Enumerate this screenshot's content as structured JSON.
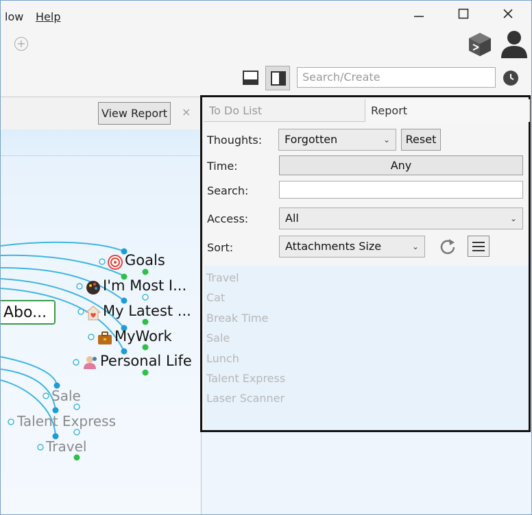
{
  "menu": {
    "partial_item": "low",
    "help": "Help"
  },
  "toolbar": {
    "search_placeholder": "Search/Create"
  },
  "left_panel": {
    "view_report_label": "View Report",
    "close_label": "×",
    "central_thought": "Abo...",
    "nodes": [
      {
        "label": "Goals"
      },
      {
        "label": "I'm Most I..."
      },
      {
        "label": "My Latest ..."
      },
      {
        "label": "MyWork"
      },
      {
        "label": "Personal Life"
      }
    ],
    "faded_nodes": [
      {
        "label": "Sale"
      },
      {
        "label": "Talent Express"
      },
      {
        "label": "Travel"
      }
    ]
  },
  "report": {
    "tabs": [
      {
        "label": "To Do List"
      },
      {
        "label": "Report"
      }
    ],
    "thoughts_label": "Thoughts:",
    "thoughts_value": "Forgotten",
    "reset_label": "Reset",
    "time_label": "Time:",
    "time_value": "Any",
    "search_label": "Search:",
    "search_value": "",
    "access_label": "Access:",
    "access_value": "All",
    "sort_label": "Sort:",
    "sort_value": "Attachments Size",
    "results": [
      {
        "label": "Travel"
      },
      {
        "label": "Cat"
      },
      {
        "label": "Break Time"
      },
      {
        "label": "Sale"
      },
      {
        "label": "Lunch"
      },
      {
        "label": "Talent Express"
      },
      {
        "label": "Laser Scanner"
      }
    ]
  },
  "colors": {
    "accent_blue": "#2a9fd8",
    "accent_green": "#22bb33",
    "panel_border": "#111111"
  }
}
